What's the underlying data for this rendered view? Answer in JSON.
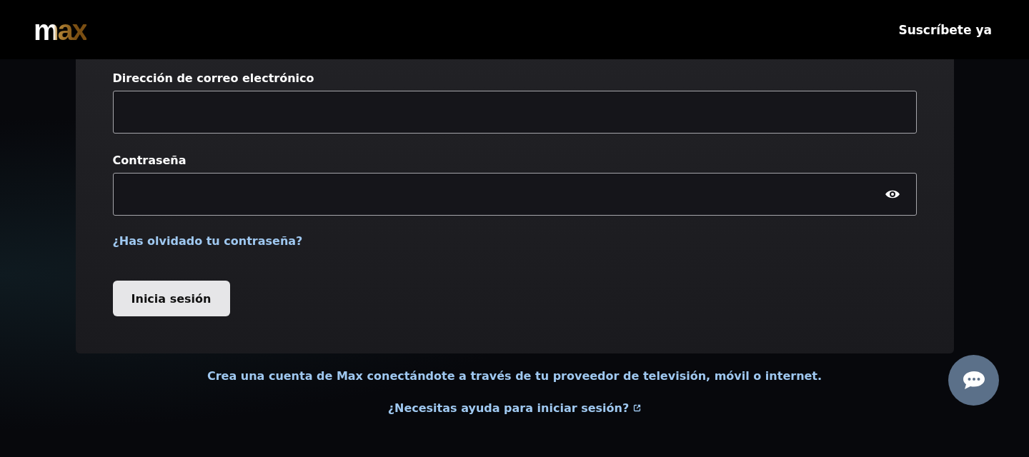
{
  "header": {
    "logo": "max",
    "subscribe": "Suscríbete ya"
  },
  "form": {
    "email_label": "Dirección de correo electrónico",
    "password_label": "Contraseña",
    "forgot_link": "¿Has olvidado tu contraseña?",
    "submit": "Inicia sesión"
  },
  "footer_links": [
    {
      "text": "Crea una cuenta de Max conectándote a través de tu proveedor de televisión, móvil o internet.",
      "external": false
    },
    {
      "text": "¿Necesitas ayuda para iniciar sesión?",
      "external": true
    }
  ]
}
